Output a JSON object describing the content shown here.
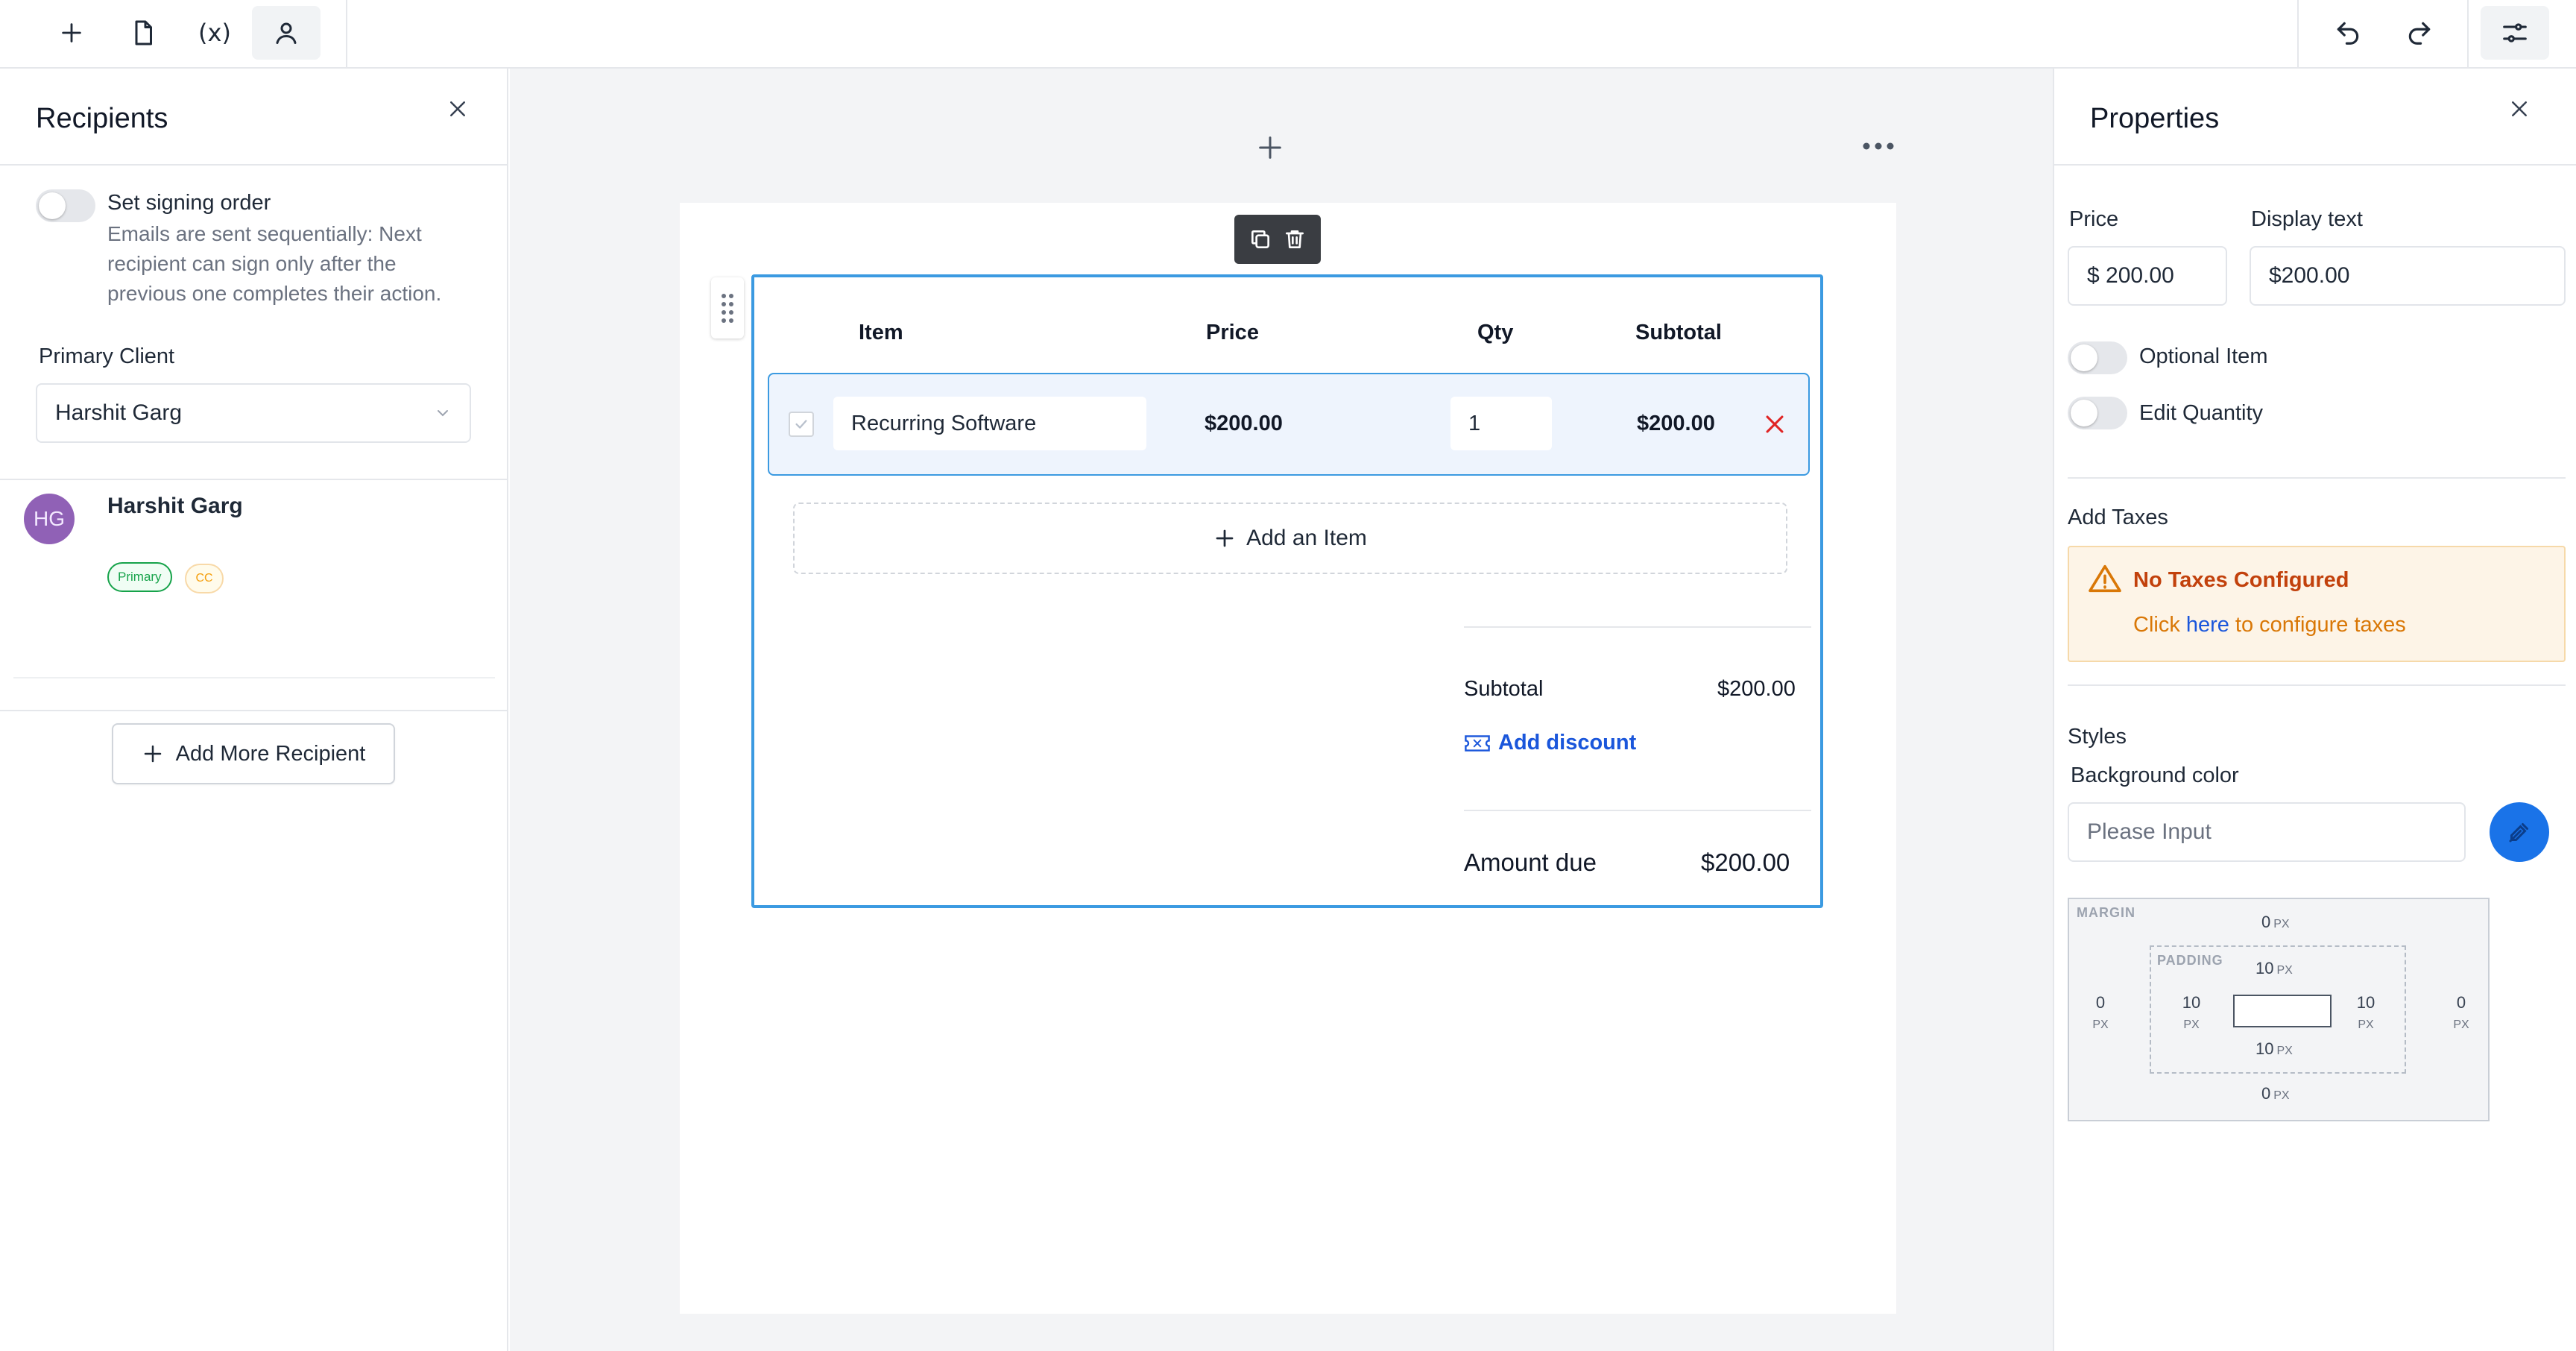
{
  "toolbar": {
    "left_icons": [
      "plus-icon",
      "document-icon",
      "variable-icon",
      "user-icon"
    ],
    "variable_label": "(x)",
    "right_icons": [
      "undo-icon",
      "redo-icon",
      "settings-sliders-icon"
    ]
  },
  "recipients": {
    "title": "Recipients",
    "signing_order": {
      "label": "Set signing order",
      "description_lines": [
        "Emails are sent sequentially: Next",
        "recipient can sign only after the",
        "previous one completes their action."
      ],
      "enabled": false
    },
    "primary_client": {
      "label": "Primary Client",
      "value": "Harshit Garg"
    },
    "list": [
      {
        "initials": "HG",
        "name": "Harshit Garg",
        "badges": [
          "Primary",
          "CC"
        ]
      }
    ],
    "add_button_label": "Add More Recipient"
  },
  "block": {
    "table": {
      "headers": [
        "Item",
        "Price",
        "Qty",
        "Subtotal"
      ],
      "rows": [
        {
          "item": "Recurring Software",
          "price": "$200.00",
          "qty": "1",
          "subtotal": "$200.00"
        }
      ]
    },
    "add_item_label": "Add an Item",
    "summary": {
      "subtotal_label": "Subtotal",
      "subtotal_value": "$200.00",
      "discount_label": "Add discount",
      "amount_due_label": "Amount due",
      "amount_due_value": "$200.00"
    }
  },
  "properties": {
    "title": "Properties",
    "price": {
      "label": "Price",
      "value": "$ 200.00"
    },
    "display_text": {
      "label": "Display text",
      "value": "$200.00"
    },
    "optional_item": {
      "label": "Optional Item",
      "enabled": false
    },
    "edit_quantity": {
      "label": "Edit Quantity",
      "enabled": false
    },
    "taxes": {
      "heading": "Add Taxes",
      "warning_title": "No Taxes Configured",
      "warning_prefix": "Click",
      "warning_link": "here",
      "warning_suffix": "to configure taxes"
    },
    "styles": {
      "heading": "Styles",
      "background_label": "Background color",
      "background_placeholder": "Please Input"
    },
    "box_model": {
      "margin_label": "MARGIN",
      "padding_label": "PADDING",
      "unit": "PX",
      "margin": {
        "top": "0",
        "right": "0",
        "bottom": "0",
        "left": "0"
      },
      "padding": {
        "top": "10",
        "right": "10",
        "bottom": "10",
        "left": "10"
      }
    }
  },
  "colors": {
    "accent": "#1a73e8",
    "selection_border": "#3b9ae1",
    "danger": "#e02424",
    "warning_bg": "#fdf4e7",
    "warning_text": "#c2410c",
    "primary_badge": "#16a34a",
    "cc_badge": "#f59e0b",
    "avatar": "#9061b6"
  }
}
